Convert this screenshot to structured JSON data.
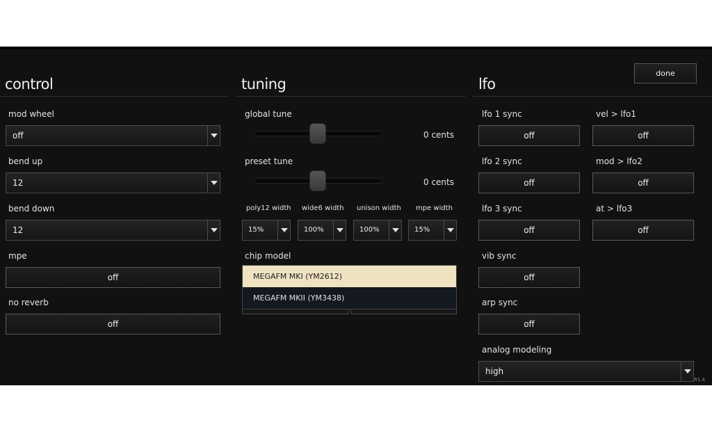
{
  "header": {
    "done_label": "done"
  },
  "control": {
    "title": "control",
    "mod_wheel": {
      "label": "mod wheel",
      "value": "off"
    },
    "bend_up": {
      "label": "bend up",
      "value": "12"
    },
    "bend_down": {
      "label": "bend down",
      "value": "12"
    },
    "mpe": {
      "label": "mpe",
      "value": "off"
    },
    "no_reverb": {
      "label": "no reverb",
      "value": "off"
    }
  },
  "tuning": {
    "title": "tuning",
    "global_tune": {
      "label": "global tune",
      "readout": "0 cents",
      "value": 0.5
    },
    "preset_tune": {
      "label": "preset tune",
      "readout": "0 cents",
      "value": 0.5
    },
    "widths": [
      {
        "label": "poly12 width",
        "value": "15%"
      },
      {
        "label": "wide6 width",
        "value": "100%"
      },
      {
        "label": "unison width",
        "value": "100%"
      },
      {
        "label": "mpe width",
        "value": "15%"
      }
    ],
    "chip_model": {
      "label": "chip model",
      "options": [
        "MEGAFM MKI (YM2612)",
        "MEGAFM MKII (YM3438)"
      ],
      "selected": "MEGAFM MKI (YM2612)"
    }
  },
  "lfo": {
    "title": "lfo",
    "lfo1_sync": {
      "label": "lfo 1 sync",
      "value": "off"
    },
    "lfo2_sync": {
      "label": "lfo 2 sync",
      "value": "off"
    },
    "lfo3_sync": {
      "label": "lfo 3 sync",
      "value": "off"
    },
    "vib_sync": {
      "label": "vib sync",
      "value": "off"
    },
    "arp_sync": {
      "label": "arp sync",
      "value": "off"
    },
    "vel_lfo1": {
      "label": "vel > lfo1",
      "value": "off"
    },
    "mod_lfo2": {
      "label": "mod > lfo2",
      "value": "off"
    },
    "at_lfo3": {
      "label": "at > lfo3",
      "value": "off"
    },
    "analog_modeling": {
      "label": "analog modeling",
      "value": "high"
    }
  },
  "footer": {
    "version": "R1.4"
  },
  "icons": {
    "dropdown_arrow": "chevron-down-icon"
  }
}
